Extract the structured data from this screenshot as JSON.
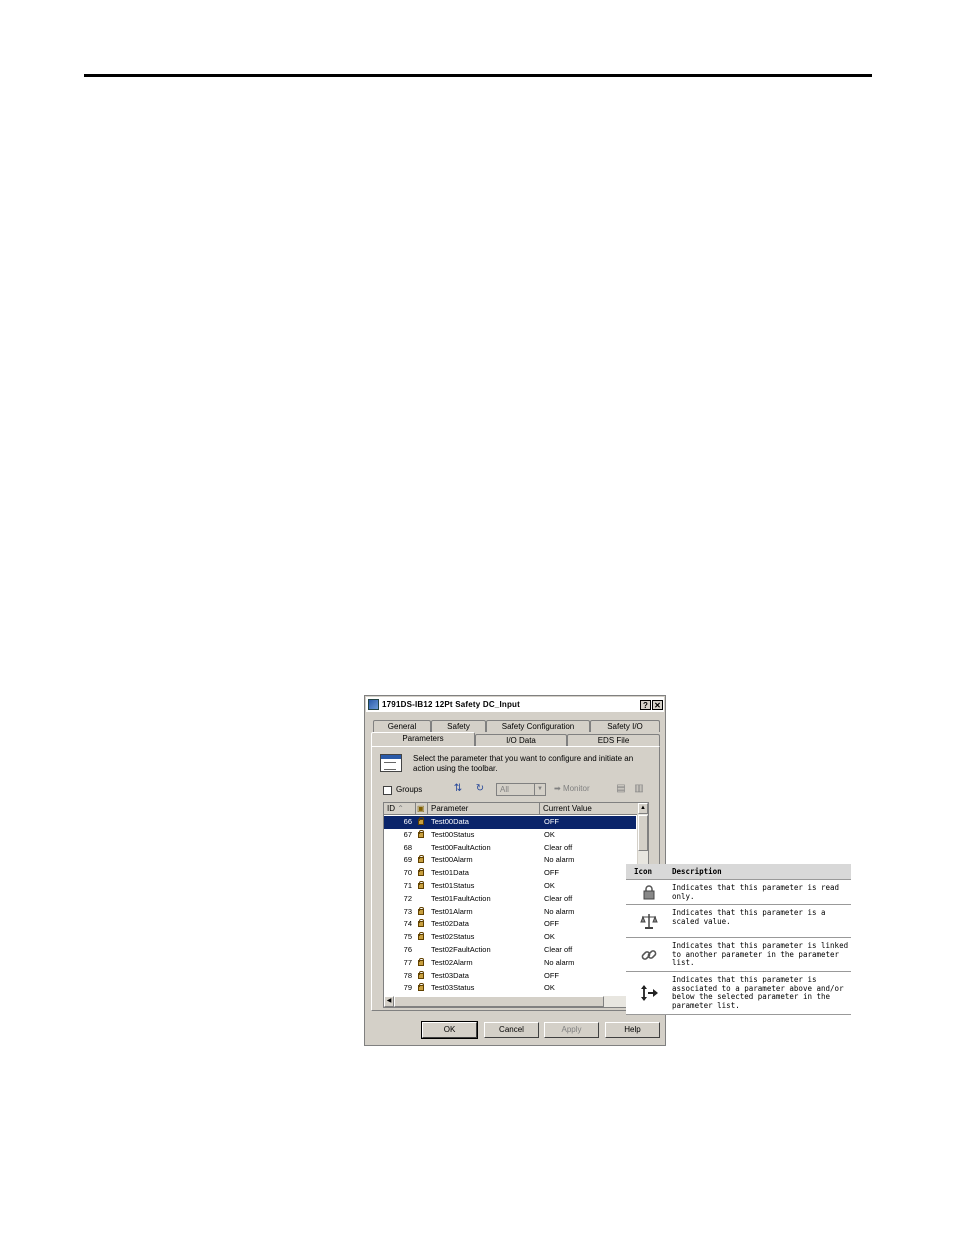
{
  "dialog": {
    "title": "1791DS-IB12 12Pt Safety DC_Input",
    "help_btn": "?",
    "close_btn": "✕",
    "tabs_back": [
      "General",
      "Safety",
      "Safety Configuration",
      "Safety I/O"
    ],
    "tabs_front": [
      "Parameters",
      "I/O Data",
      "EDS File"
    ],
    "info_text": "Select the parameter that you want to configure and initiate an action using the toolbar.",
    "toolbar": {
      "groups_label": "Groups",
      "combo_value": "All",
      "monitor_label": "Monitor"
    },
    "grid": {
      "headers": [
        "ID",
        "",
        "Parameter",
        "Current Value"
      ],
      "rows": [
        {
          "id": "66",
          "locked": true,
          "param": "Test00Data",
          "value": "OFF"
        },
        {
          "id": "67",
          "locked": true,
          "param": "Test00Status",
          "value": "OK"
        },
        {
          "id": "68",
          "locked": false,
          "param": "Test00FaultAction",
          "value": "Clear off"
        },
        {
          "id": "69",
          "locked": true,
          "param": "Test00Alarm",
          "value": "No alarm"
        },
        {
          "id": "70",
          "locked": true,
          "param": "Test01Data",
          "value": "OFF"
        },
        {
          "id": "71",
          "locked": true,
          "param": "Test01Status",
          "value": "OK"
        },
        {
          "id": "72",
          "locked": false,
          "param": "Test01FaultAction",
          "value": "Clear off"
        },
        {
          "id": "73",
          "locked": true,
          "param": "Test01Alarm",
          "value": "No alarm"
        },
        {
          "id": "74",
          "locked": true,
          "param": "Test02Data",
          "value": "OFF"
        },
        {
          "id": "75",
          "locked": true,
          "param": "Test02Status",
          "value": "OK"
        },
        {
          "id": "76",
          "locked": false,
          "param": "Test02FaultAction",
          "value": "Clear off"
        },
        {
          "id": "77",
          "locked": true,
          "param": "Test02Alarm",
          "value": "No alarm"
        },
        {
          "id": "78",
          "locked": true,
          "param": "Test03Data",
          "value": "OFF"
        },
        {
          "id": "79",
          "locked": true,
          "param": "Test03Status",
          "value": "OK"
        }
      ]
    },
    "buttons": {
      "ok": "OK",
      "cancel": "Cancel",
      "apply": "Apply",
      "help": "Help"
    }
  },
  "legend": {
    "headers": [
      "Icon",
      "Description"
    ],
    "rows": [
      {
        "icon": "lock-icon",
        "text": "Indicates that this parameter is read only."
      },
      {
        "icon": "scale-icon",
        "text": "Indicates that this parameter is a scaled value."
      },
      {
        "icon": "link-icon",
        "text": "Indicates that this parameter is linked to another parameter in the parameter list."
      },
      {
        "icon": "association-arrows-icon",
        "text": "Indicates that this parameter is associated to a parameter above and/or below the selected parameter in the parameter list."
      }
    ]
  }
}
